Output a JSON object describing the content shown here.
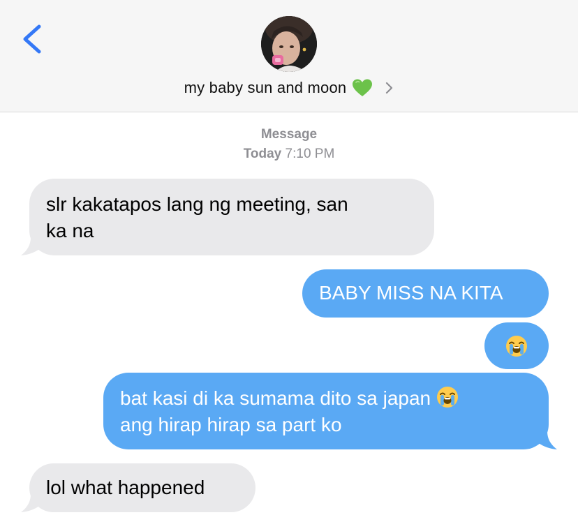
{
  "header": {
    "contact_name": "my baby sun and moon",
    "contact_emoji": "green-heart-icon",
    "back_icon": "chevron-left-icon",
    "disclosure_icon": "chevron-right-icon",
    "accent_color": "#3478f6"
  },
  "timestamp": {
    "kind": "Message",
    "day": "Today",
    "time": "7:10 PM"
  },
  "messages": [
    {
      "direction": "received",
      "lines": [
        "slr kakatapos lang ng meeting, san",
        "ka na"
      ]
    },
    {
      "direction": "sent",
      "text": "BABY MISS NA KITA"
    },
    {
      "direction": "sent",
      "emoji": "loudly-crying-face-icon"
    },
    {
      "direction": "sent",
      "lines": [
        "bat kasi di ka sumama dito sa japan",
        "ang hirap hirap sa part ko"
      ],
      "trailing_emoji": "loudly-crying-face-icon"
    },
    {
      "direction": "received",
      "text": "lol what happened"
    }
  ],
  "colors": {
    "sent_bubble": "#5aa9f4",
    "received_bubble": "#e9e9eb",
    "header_bg": "#f6f6f6",
    "meta_text": "#8e8e93"
  }
}
